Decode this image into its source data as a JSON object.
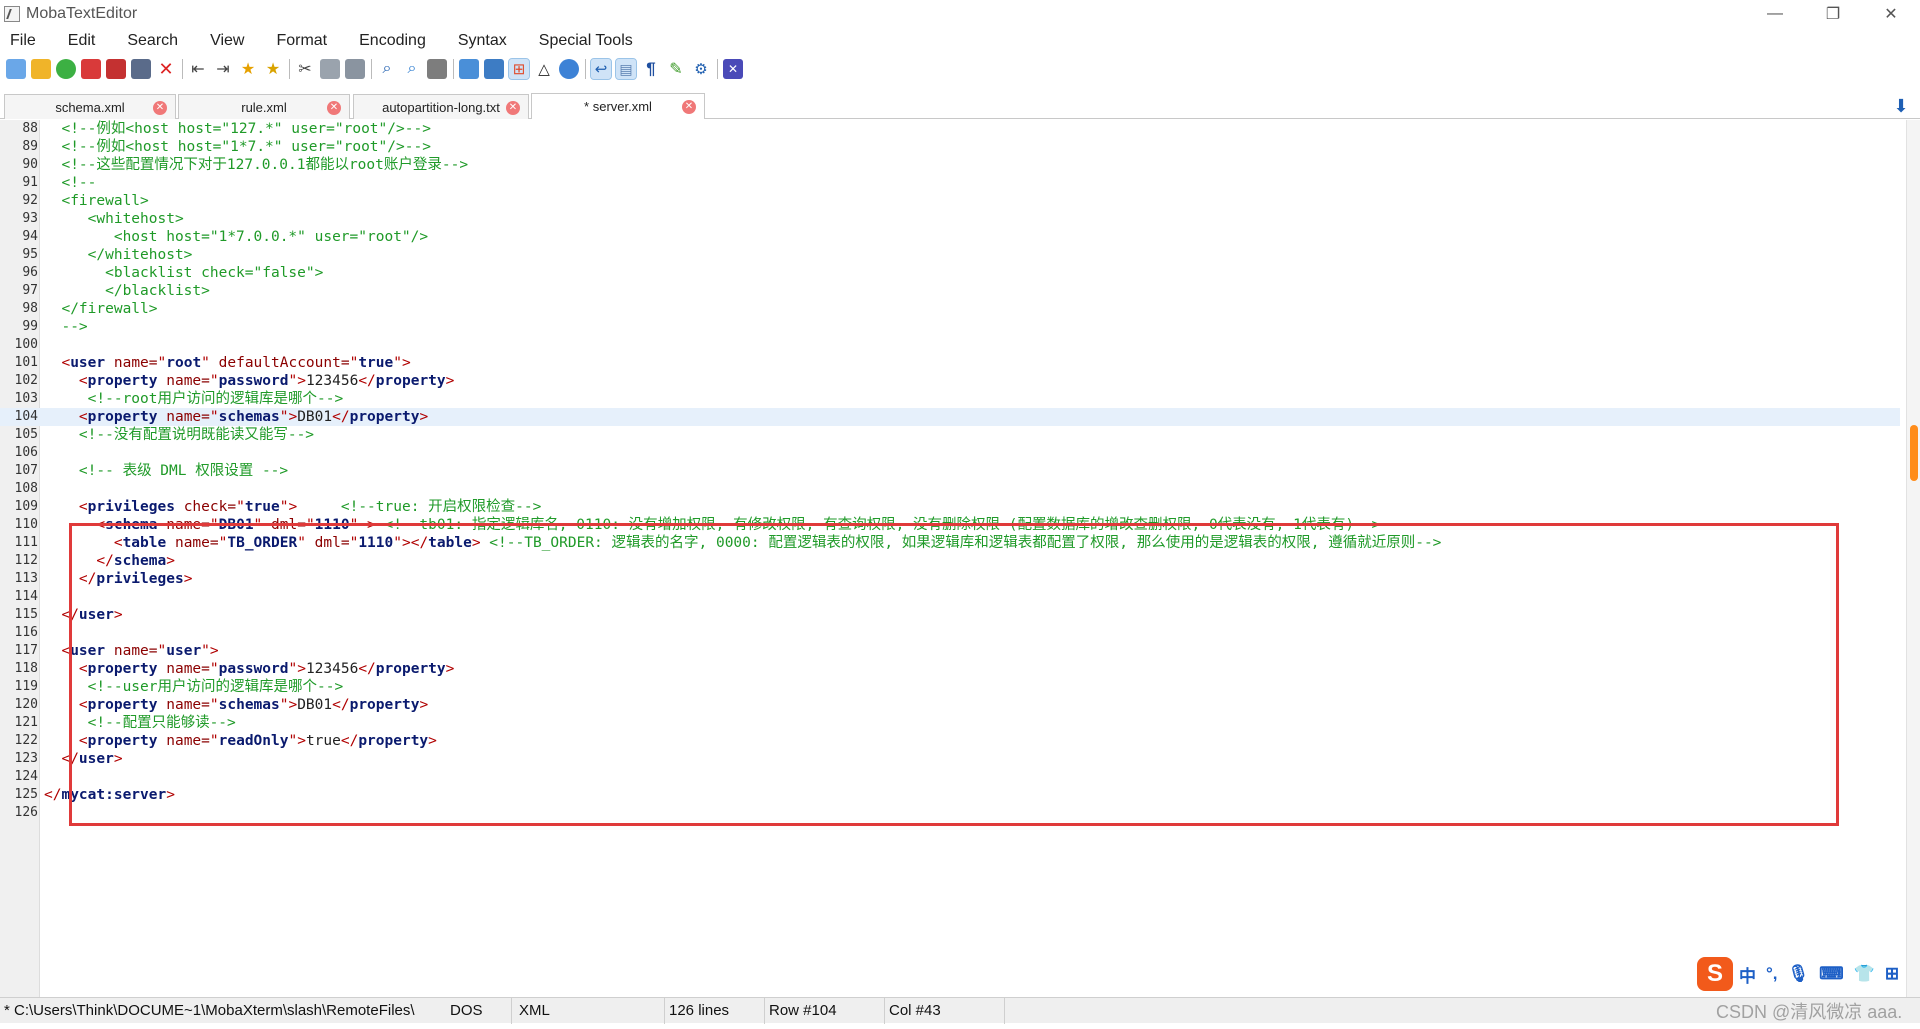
{
  "window": {
    "title": "MobaTextEditor",
    "minimize": "—",
    "restore": "❐",
    "close": "✕"
  },
  "menu": [
    "File",
    "Edit",
    "Search",
    "View",
    "Format",
    "Encoding",
    "Syntax",
    "Special Tools"
  ],
  "tabs": [
    {
      "label": "schema.xml",
      "active": false
    },
    {
      "label": "rule.xml",
      "active": false
    },
    {
      "label": "autopartition-long.txt",
      "active": false
    },
    {
      "label": "* server.xml",
      "active": true
    }
  ],
  "editor": {
    "current_line": 104,
    "lines": [
      {
        "n": "88",
        "seg": [
          [
            "c-com",
            "  <!--例如<host host=\"127.*\" user=\"root\"/>-->"
          ]
        ]
      },
      {
        "n": "89",
        "seg": [
          [
            "c-com",
            "  <!--例如<host host=\"1*7.*\" user=\"root\"/>-->"
          ]
        ]
      },
      {
        "n": "90",
        "seg": [
          [
            "c-com",
            "  <!--这些配置情况下对于127.0.0.1都能以root账户登录-->"
          ]
        ]
      },
      {
        "n": "91",
        "seg": [
          [
            "c-com",
            "  <!--"
          ]
        ]
      },
      {
        "n": "92",
        "seg": [
          [
            "c-com",
            "  <firewall>"
          ]
        ]
      },
      {
        "n": "93",
        "seg": [
          [
            "c-com",
            "     <whitehost>"
          ]
        ]
      },
      {
        "n": "94",
        "seg": [
          [
            "c-com",
            "        <host host=\"1*7.0.0.*\" user=\"root\"/>"
          ]
        ]
      },
      {
        "n": "95",
        "seg": [
          [
            "c-com",
            "     </whitehost>"
          ]
        ]
      },
      {
        "n": "96",
        "seg": [
          [
            "c-com",
            "       <blacklist check=\"false\">"
          ]
        ]
      },
      {
        "n": "97",
        "seg": [
          [
            "c-com",
            "       </blacklist>"
          ]
        ]
      },
      {
        "n": "98",
        "seg": [
          [
            "c-com",
            "  </firewall>"
          ]
        ]
      },
      {
        "n": "99",
        "seg": [
          [
            "c-com",
            "  -->"
          ]
        ]
      },
      {
        "n": "100",
        "seg": []
      },
      {
        "n": "101",
        "seg": [
          [
            "c-tag",
            "  <"
          ],
          [
            "c-tn",
            "user"
          ],
          [
            "c-attr",
            " name="
          ],
          [
            "c-tag",
            "\""
          ],
          [
            "c-val",
            "root"
          ],
          [
            "c-tag",
            "\""
          ],
          [
            "c-attr",
            " defaultAccount="
          ],
          [
            "c-tag",
            "\""
          ],
          [
            "c-val",
            "true"
          ],
          [
            "c-tag",
            "\">"
          ]
        ]
      },
      {
        "n": "102",
        "seg": [
          [
            "c-tag",
            "    <"
          ],
          [
            "c-tn",
            "property"
          ],
          [
            "c-attr",
            " name="
          ],
          [
            "c-tag",
            "\""
          ],
          [
            "c-val",
            "password"
          ],
          [
            "c-tag",
            "\">"
          ],
          [
            "c-txt",
            "123456"
          ],
          [
            "c-tag",
            "</"
          ],
          [
            "c-tn",
            "property"
          ],
          [
            "c-tag",
            ">"
          ]
        ]
      },
      {
        "n": "103",
        "seg": [
          [
            "c-com",
            "     <!--root用户访问的逻辑库是哪个-->"
          ]
        ]
      },
      {
        "n": "104",
        "seg": [
          [
            "c-tag",
            "    <"
          ],
          [
            "c-tn",
            "property"
          ],
          [
            "c-attr",
            " name="
          ],
          [
            "c-tag",
            "\""
          ],
          [
            "c-val",
            "schemas"
          ],
          [
            "c-tag",
            "\">"
          ],
          [
            "c-txt",
            "DB01"
          ],
          [
            "c-tag",
            "</"
          ],
          [
            "c-tn",
            "property"
          ],
          [
            "c-tag",
            ">"
          ]
        ]
      },
      {
        "n": "105",
        "seg": [
          [
            "c-com",
            "    <!--没有配置说明既能读又能写-->"
          ]
        ]
      },
      {
        "n": "106",
        "seg": []
      },
      {
        "n": "107",
        "seg": [
          [
            "c-com",
            "    <!-- 表级 DML 权限设置 -->"
          ]
        ]
      },
      {
        "n": "108",
        "seg": []
      },
      {
        "n": "109",
        "seg": [
          [
            "c-tag",
            "    <"
          ],
          [
            "c-tn",
            "privileges"
          ],
          [
            "c-attr",
            " check="
          ],
          [
            "c-tag",
            "\""
          ],
          [
            "c-val",
            "true"
          ],
          [
            "c-tag",
            "\">"
          ],
          [
            "c-txt",
            "     "
          ],
          [
            "c-com",
            "<!--true: 开启权限检查-->"
          ]
        ]
      },
      {
        "n": "110",
        "seg": [
          [
            "c-tag",
            "      <"
          ],
          [
            "c-tn",
            "schema"
          ],
          [
            "c-attr",
            " name="
          ],
          [
            "c-tag",
            "\""
          ],
          [
            "c-val",
            "DB01"
          ],
          [
            "c-tag",
            "\""
          ],
          [
            "c-attr",
            " dml="
          ],
          [
            "c-tag",
            "\""
          ],
          [
            "c-val",
            "1110"
          ],
          [
            "c-tag",
            "\" > "
          ],
          [
            "c-com",
            "<!--tb01: 指定逻辑库名, 0110: 没有增加权限, 有修改权限, 有查询权限, 没有删除权限 (配置数据库的增改查删权限, 0代表没有, 1代表有)-->"
          ]
        ]
      },
      {
        "n": "111",
        "seg": [
          [
            "c-tag",
            "        <"
          ],
          [
            "c-tn",
            "table"
          ],
          [
            "c-attr",
            " name="
          ],
          [
            "c-tag",
            "\""
          ],
          [
            "c-val",
            "TB_ORDER"
          ],
          [
            "c-tag",
            "\""
          ],
          [
            "c-attr",
            " dml="
          ],
          [
            "c-tag",
            "\""
          ],
          [
            "c-val",
            "1110"
          ],
          [
            "c-tag",
            "\"></"
          ],
          [
            "c-tn",
            "table"
          ],
          [
            "c-tag",
            "> "
          ],
          [
            "c-com",
            "<!--TB_ORDER: 逻辑表的名字, 0000: 配置逻辑表的权限, 如果逻辑库和逻辑表都配置了权限, 那么使用的是逻辑表的权限, 遵循就近原则-->"
          ]
        ]
      },
      {
        "n": "112",
        "seg": [
          [
            "c-tag",
            "      </"
          ],
          [
            "c-tn",
            "schema"
          ],
          [
            "c-tag",
            ">"
          ]
        ]
      },
      {
        "n": "113",
        "seg": [
          [
            "c-tag",
            "    </"
          ],
          [
            "c-tn",
            "privileges"
          ],
          [
            "c-tag",
            ">"
          ]
        ]
      },
      {
        "n": "114",
        "seg": []
      },
      {
        "n": "115",
        "seg": [
          [
            "c-tag",
            "  </"
          ],
          [
            "c-tn",
            "user"
          ],
          [
            "c-tag",
            ">"
          ]
        ]
      },
      {
        "n": "116",
        "seg": []
      },
      {
        "n": "117",
        "seg": [
          [
            "c-tag",
            "  <"
          ],
          [
            "c-tn",
            "user"
          ],
          [
            "c-attr",
            " name="
          ],
          [
            "c-tag",
            "\""
          ],
          [
            "c-val",
            "user"
          ],
          [
            "c-tag",
            "\">"
          ]
        ]
      },
      {
        "n": "118",
        "seg": [
          [
            "c-tag",
            "    <"
          ],
          [
            "c-tn",
            "property"
          ],
          [
            "c-attr",
            " name="
          ],
          [
            "c-tag",
            "\""
          ],
          [
            "c-val",
            "password"
          ],
          [
            "c-tag",
            "\">"
          ],
          [
            "c-txt",
            "123456"
          ],
          [
            "c-tag",
            "</"
          ],
          [
            "c-tn",
            "property"
          ],
          [
            "c-tag",
            ">"
          ]
        ]
      },
      {
        "n": "119",
        "seg": [
          [
            "c-com",
            "     <!--user用户访问的逻辑库是哪个-->"
          ]
        ]
      },
      {
        "n": "120",
        "seg": [
          [
            "c-tag",
            "    <"
          ],
          [
            "c-tn",
            "property"
          ],
          [
            "c-attr",
            " name="
          ],
          [
            "c-tag",
            "\""
          ],
          [
            "c-val",
            "schemas"
          ],
          [
            "c-tag",
            "\">"
          ],
          [
            "c-txt",
            "DB01"
          ],
          [
            "c-tag",
            "</"
          ],
          [
            "c-tn",
            "property"
          ],
          [
            "c-tag",
            ">"
          ]
        ]
      },
      {
        "n": "121",
        "seg": [
          [
            "c-com",
            "     <!--配置只能够读-->"
          ]
        ]
      },
      {
        "n": "122",
        "seg": [
          [
            "c-tag",
            "    <"
          ],
          [
            "c-tn",
            "property"
          ],
          [
            "c-attr",
            " name="
          ],
          [
            "c-tag",
            "\""
          ],
          [
            "c-val",
            "readOnly"
          ],
          [
            "c-tag",
            "\">"
          ],
          [
            "c-txt",
            "true"
          ],
          [
            "c-tag",
            "</"
          ],
          [
            "c-tn",
            "property"
          ],
          [
            "c-tag",
            ">"
          ]
        ]
      },
      {
        "n": "123",
        "seg": [
          [
            "c-tag",
            "  </"
          ],
          [
            "c-tn",
            "user"
          ],
          [
            "c-tag",
            ">"
          ]
        ]
      },
      {
        "n": "124",
        "seg": []
      },
      {
        "n": "125",
        "seg": [
          [
            "c-tag",
            "</"
          ],
          [
            "c-tn",
            "mycat:server"
          ],
          [
            "c-tag",
            ">"
          ]
        ]
      },
      {
        "n": "126",
        "seg": []
      }
    ]
  },
  "status": {
    "path": "* C:\\Users\\Think\\DOCUME~1\\MobaXterm\\slash\\RemoteFiles\\",
    "eol": "DOS",
    "syntax": "XML",
    "lines": "126 lines",
    "row": "Row #104",
    "col": "Col #43"
  },
  "ime": {
    "logo": "S",
    "lang": "中"
  },
  "watermark": "CSDN @清风微凉 aaa."
}
